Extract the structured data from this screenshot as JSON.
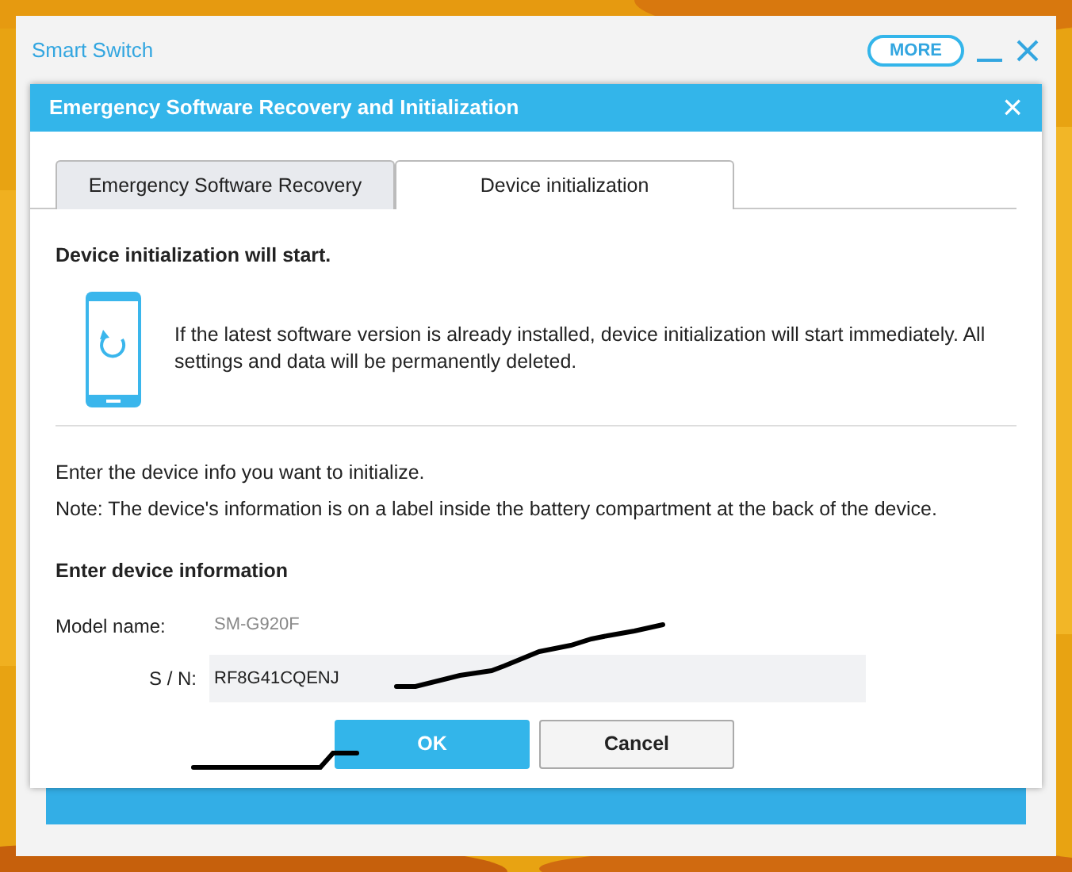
{
  "window": {
    "title": "Smart Switch",
    "more_button": "MORE"
  },
  "dialog": {
    "title": "Emergency Software Recovery and Initialization",
    "close": "×",
    "tabs": [
      {
        "label": "Emergency Software Recovery",
        "selected": false
      },
      {
        "label": "Device initialization",
        "selected": true
      }
    ],
    "heading": "Device initialization will start.",
    "message": "If the latest software version is already installed, device initialization will start immediately. All settings and data will be permanently deleted.",
    "instructions": [
      "Enter the device info you want to initialize.",
      "Note: The device's information is on a label inside the battery compartment at the back of the device."
    ],
    "form_heading": "Enter device information",
    "fields": [
      {
        "label": "Model name:",
        "value": "SM-G920F",
        "kind": "readonly"
      },
      {
        "label": "S / N:",
        "value": "RF8G41CQENJ",
        "kind": "input"
      }
    ],
    "buttons": [
      {
        "label": "OK",
        "kind": "primary"
      },
      {
        "label": "Cancel",
        "kind": "secondary"
      }
    ]
  }
}
